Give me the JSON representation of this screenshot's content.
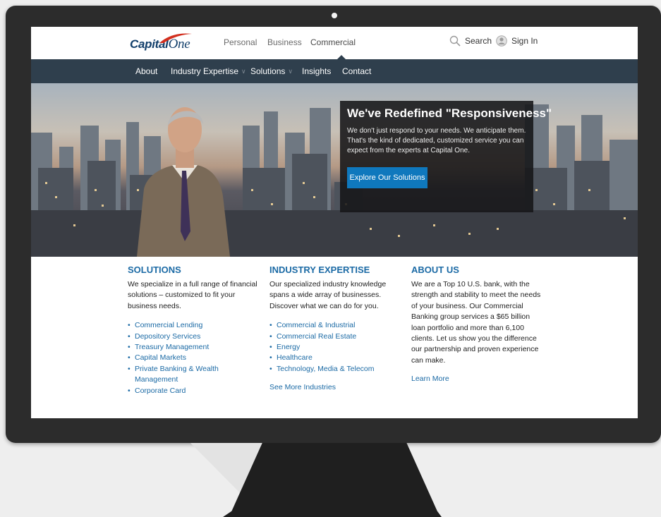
{
  "brand": {
    "logo_text_capital": "Capital",
    "logo_text_one": "One",
    "primary_color": "#123f6b",
    "accent_color": "#d22e1e",
    "link_color": "#1b6aa5",
    "nav_bg": "#2f3f4d",
    "cta_color": "#0f78bd"
  },
  "segments": [
    {
      "label": "Personal",
      "active": false
    },
    {
      "label": "Business",
      "active": false
    },
    {
      "label": "Commercial",
      "active": true
    }
  ],
  "utility": {
    "search_label": "Search",
    "search_icon": "search-icon",
    "signin_label": "Sign In",
    "signin_icon": "user-icon"
  },
  "nav": [
    {
      "label": "About",
      "has_dropdown": false
    },
    {
      "label": "Industry Expertise",
      "has_dropdown": true
    },
    {
      "label": "Solutions",
      "has_dropdown": true
    },
    {
      "label": "Insights",
      "has_dropdown": false
    },
    {
      "label": "Contact",
      "has_dropdown": false
    }
  ],
  "hero": {
    "title": "We've Redefined \"Responsiveness\"",
    "body": "We don't just respond to your needs. We anticipate them. That's the kind of dedicated, customized service you can expect from the experts at Capital One.",
    "cta_label": "Explore Our Solutions"
  },
  "columns": {
    "solutions": {
      "heading": "SOLUTIONS",
      "intro": "We specialize in a full range of financial solutions – customized to fit your business needs.",
      "links": [
        "Commercial Lending",
        "Depository Services",
        "Treasury Management",
        "Capital Markets",
        "Private Banking & Wealth Management",
        "Corporate Card"
      ]
    },
    "industry": {
      "heading": "INDUSTRY EXPERTISE",
      "intro": "Our specialized industry knowledge spans a wide array of businesses. Discover what we can do for you.",
      "links": [
        "Commercial & Industrial",
        "Commercial Real Estate",
        "Energy",
        "Healthcare",
        "Technology, Media & Telecom"
      ],
      "more_label": "See More Industries"
    },
    "about": {
      "heading": "ABOUT US",
      "intro": "We are a Top 10 U.S. bank, with the strength and stability to meet the needs of your business. Our Commercial Banking group services a $65 billion loan portfolio and more than 6,100 clients. Let us show you the difference our partnership and proven experience can make.",
      "more_label": "Learn More"
    }
  }
}
